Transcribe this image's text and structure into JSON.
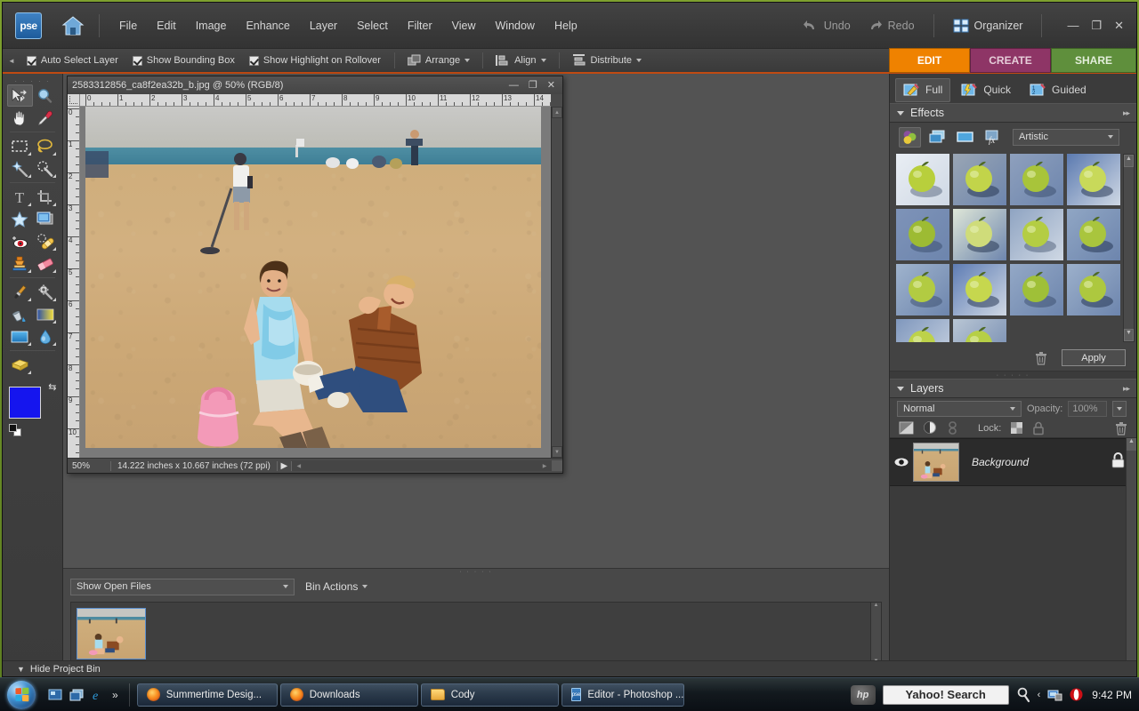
{
  "app": {
    "logo_text": "pse",
    "window_controls": {
      "minimize": "—",
      "maximize": "❐",
      "close": "✕"
    }
  },
  "menubar": {
    "items": [
      "File",
      "Edit",
      "Image",
      "Enhance",
      "Layer",
      "Select",
      "Filter",
      "View",
      "Window",
      "Help"
    ],
    "undo_label": "Undo",
    "redo_label": "Redo",
    "organizer_label": "Organizer"
  },
  "mode_tabs_top": [
    {
      "label": "EDIT",
      "color": "#ef8200",
      "active": true
    },
    {
      "label": "CREATE",
      "color": "#8e3566",
      "active": false
    },
    {
      "label": "SHARE",
      "color": "#5f8f3c",
      "active": false
    }
  ],
  "options_bar": {
    "checkboxes": [
      {
        "label": "Auto Select Layer",
        "checked": true
      },
      {
        "label": "Show Bounding Box",
        "checked": true
      },
      {
        "label": "Show Highlight on Rollover",
        "checked": true
      }
    ],
    "buttons": [
      {
        "label": "Arrange",
        "icon": "arrange-icon"
      },
      {
        "label": "Align",
        "icon": "align-icon"
      },
      {
        "label": "Distribute",
        "icon": "distribute-icon"
      }
    ]
  },
  "toolbox": {
    "tools": [
      {
        "name": "move-tool",
        "icon": "move-icon",
        "selected": true,
        "has_flyout": false
      },
      {
        "name": "zoom-tool",
        "icon": "magnifier-icon",
        "selected": false,
        "has_flyout": false
      },
      {
        "name": "hand-tool",
        "icon": "hand-icon",
        "selected": false,
        "has_flyout": false
      },
      {
        "name": "eyedropper-tool",
        "icon": "eyedropper-icon",
        "selected": false,
        "has_flyout": false
      },
      {
        "name": "marquee-tool",
        "icon": "rectangular-marquee-icon",
        "selected": false,
        "has_flyout": true
      },
      {
        "name": "lasso-tool",
        "icon": "lasso-icon",
        "selected": false,
        "has_flyout": true
      },
      {
        "name": "magic-wand-tool",
        "icon": "magic-wand-icon",
        "selected": false,
        "has_flyout": true
      },
      {
        "name": "quick-selection-tool",
        "icon": "quick-selection-icon",
        "selected": false,
        "has_flyout": true
      },
      {
        "name": "type-tool",
        "icon": "type-t-icon",
        "selected": false,
        "has_flyout": true
      },
      {
        "name": "crop-tool",
        "icon": "crop-icon",
        "selected": false,
        "has_flyout": false
      },
      {
        "name": "cookie-cutter-tool",
        "icon": "star-cookie-cutter-icon",
        "selected": false,
        "has_flyout": false
      },
      {
        "name": "straighten-tool",
        "icon": "straighten-icon",
        "selected": false,
        "has_flyout": false
      },
      {
        "name": "red-eye-removal-tool",
        "icon": "red-eye-icon",
        "selected": false,
        "has_flyout": false
      },
      {
        "name": "healing-brush-tool",
        "icon": "bandage-healing-icon",
        "selected": false,
        "has_flyout": true
      },
      {
        "name": "clone-stamp-tool",
        "icon": "clone-stamp-icon",
        "selected": false,
        "has_flyout": true
      },
      {
        "name": "eraser-tool",
        "icon": "eraser-icon",
        "selected": false,
        "has_flyout": true
      },
      {
        "name": "brush-tool",
        "icon": "paintbrush-icon",
        "selected": false,
        "has_flyout": true
      },
      {
        "name": "smart-brush-tool",
        "icon": "smart-brush-gear-icon",
        "selected": false,
        "has_flyout": true
      },
      {
        "name": "paint-bucket-tool",
        "icon": "paint-bucket-icon",
        "selected": false,
        "has_flyout": false
      },
      {
        "name": "gradient-tool",
        "icon": "gradient-icon",
        "selected": false,
        "has_flyout": true
      },
      {
        "name": "shape-tool",
        "icon": "rectangle-shape-icon",
        "selected": false,
        "has_flyout": true
      },
      {
        "name": "blur-tool",
        "icon": "water-drop-blur-icon",
        "selected": false,
        "has_flyout": true
      },
      {
        "name": "sponge-tool",
        "icon": "sponge-icon",
        "selected": false,
        "has_flyout": true
      }
    ],
    "foreground_color": "#1515ee",
    "background_color": "#ffffff"
  },
  "document": {
    "title": "2583312856_ca8f2ea32b_b.jpg @ 50% (RGB/8)",
    "zoom": "50%",
    "dimensions": "14.222 inches x 10.667 inches (72 ppi)",
    "h_ruler_labels": [
      "0",
      "1",
      "2",
      "3",
      "4",
      "5",
      "6",
      "7",
      "8",
      "9",
      "10",
      "11",
      "12",
      "13",
      "14"
    ],
    "v_ruler_labels": [
      "0",
      "1",
      "2",
      "3",
      "4",
      "5",
      "6",
      "7",
      "8",
      "9",
      "10"
    ],
    "window_controls": {
      "minimize": "—",
      "maximize": "❐",
      "close": "✕"
    }
  },
  "project_bin": {
    "filter_label": "Show Open Files",
    "bin_actions_label": "Bin Actions",
    "hide_label": "Hide Project Bin",
    "thumbnails": [
      {
        "name": "beach-photo-thumb",
        "selected": true
      }
    ]
  },
  "right_panel": {
    "edit_modes": [
      {
        "label": "Full",
        "icon": "full-edit-icon",
        "active": true
      },
      {
        "label": "Quick",
        "icon": "quick-edit-icon",
        "active": false
      },
      {
        "label": "Guided",
        "icon": "guided-edit-icon",
        "active": false
      }
    ],
    "effects": {
      "title": "Effects",
      "category_buttons": [
        {
          "name": "filters-button",
          "icon": "colored-circles-icon",
          "selected": true
        },
        {
          "name": "layer-styles-button",
          "icon": "layers-stack-icon",
          "selected": false
        },
        {
          "name": "photo-effects-button",
          "icon": "photo-frame-icon",
          "selected": false
        },
        {
          "name": "all-effects-button",
          "icon": "fx-icon",
          "selected": false
        }
      ],
      "category_selected": "Artistic",
      "apply_label": "Apply",
      "delete_icon": "trash-icon",
      "thumbnails": [
        {
          "name": "colored-pencil"
        },
        {
          "name": "cutout"
        },
        {
          "name": "dry-brush"
        },
        {
          "name": "film-grain"
        },
        {
          "name": "fresco"
        },
        {
          "name": "neon-glow"
        },
        {
          "name": "paint-daubs"
        },
        {
          "name": "palette-knife"
        },
        {
          "name": "plastic-wrap"
        },
        {
          "name": "poster-edges"
        },
        {
          "name": "rough-pastels"
        },
        {
          "name": "smudge-stick"
        },
        {
          "name": "sponge"
        },
        {
          "name": "underpainting"
        }
      ]
    },
    "layers": {
      "title": "Layers",
      "blend_mode": "Normal",
      "opacity_label": "Opacity:",
      "opacity_value": "100%",
      "lock_label": "Lock:",
      "buttons": [
        {
          "name": "new-layer-button",
          "icon": "new-layer-icon"
        },
        {
          "name": "adjustment-layer-button",
          "icon": "half-circle-adjustment-icon"
        },
        {
          "name": "link-layers-button",
          "icon": "link-icon"
        },
        {
          "name": "lock-transparency-button",
          "icon": "checkerboard-lock-icon"
        },
        {
          "name": "lock-all-button",
          "icon": "padlock-icon"
        },
        {
          "name": "delete-layer-button",
          "icon": "trash-icon"
        }
      ],
      "items": [
        {
          "name": "Background",
          "visible": true,
          "locked": true
        }
      ]
    }
  },
  "taskbar": {
    "start_label": "Start",
    "quick_launch": [
      {
        "name": "show-desktop-icon"
      },
      {
        "name": "switch-windows-icon"
      },
      {
        "name": "internet-explorer-icon"
      },
      {
        "name": "chevron-more-icon",
        "label": "»"
      }
    ],
    "tasks": [
      {
        "label": "Summertime Desig...",
        "icon": "firefox-icon"
      },
      {
        "label": "Downloads",
        "icon": "firefox-icon"
      },
      {
        "label": "Cody",
        "icon": "folder-icon"
      },
      {
        "label": "Editor - Photoshop ...",
        "icon": "pse-icon"
      }
    ],
    "tray": {
      "hp_label": "hp",
      "search_placeholder": "Yahoo! Search",
      "search_value": "Yahoo! Search",
      "icons": [
        "search-icon",
        "chevron-left-icon",
        "network-icon",
        "opera-icon"
      ],
      "clock": "9:42 PM"
    }
  },
  "colors": {
    "accent_orange": "#ef8200",
    "accent_magenta": "#8e3566",
    "accent_green": "#5f8f3c",
    "panel_bg": "#3b3b3b",
    "menu_bg": "#3a3a3a",
    "desktop_green": "#6d9028"
  }
}
